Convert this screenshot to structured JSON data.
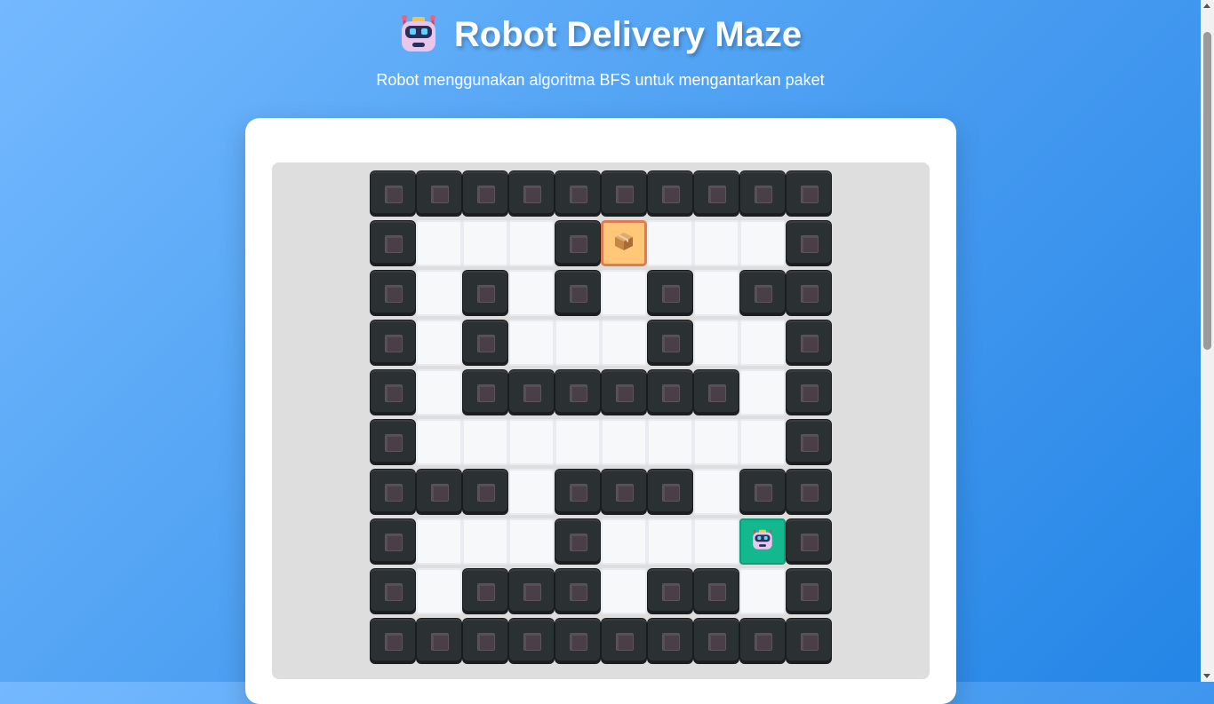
{
  "header": {
    "title": "Robot Delivery Maze",
    "subtitle": "Robot menggunakan algoritma BFS untuk mengantarkan paket",
    "title_icon": "robot-icon"
  },
  "maze": {
    "rows": 10,
    "cols": 10,
    "legend": {
      "W": "wall",
      ".": "path",
      "P": "package",
      "R": "robot"
    },
    "layout": [
      "WWWWWWWWWW",
      "W...WP...W",
      "W.W.W.W.WW",
      "W.W...W..W",
      "W.WWWWWW.W",
      "W........W",
      "WWW.WWW.WW",
      "W...W...RW",
      "W.WWW.WW.W",
      "WWWWWWWWWW"
    ],
    "package_position": {
      "row": 1,
      "col": 5
    },
    "robot_position": {
      "row": 7,
      "col": 8
    },
    "icons": {
      "wall": "wall-block-icon",
      "package": "package-icon",
      "robot": "robot-icon"
    }
  },
  "colors": {
    "background_start": "#74b9ff",
    "background_end": "#2385e6",
    "wall": "#2b3033",
    "path": "#f7f8fa",
    "package_cell": "#ffc777",
    "package_border": "#e07a50",
    "robot_cell": "#13b88f"
  }
}
